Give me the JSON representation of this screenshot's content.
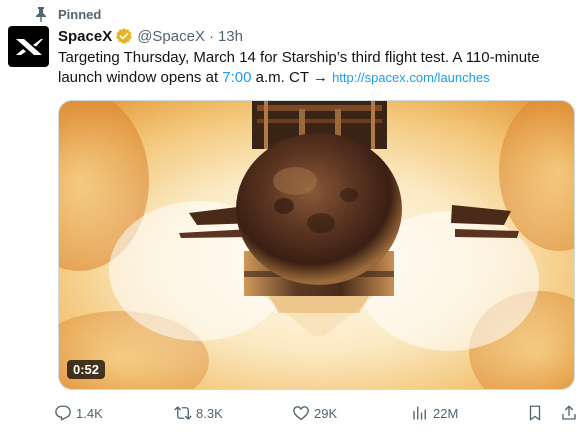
{
  "pinned": {
    "label": "Pinned",
    "icon": "pin-icon"
  },
  "author": {
    "name": "SpaceX",
    "handle": "@SpaceX",
    "separator": "·",
    "time": "13h",
    "verified_icon": "verified-badge-icon",
    "verified_color": "#e7b325",
    "avatar_icon": "spacex-logo-icon"
  },
  "tweet": {
    "text_part1": "Targeting Thursday, March 14 for Starship’s third flight test. A 110-minute launch window opens at ",
    "time_link": "7:00",
    "text_part2": " a.m. CT → ",
    "url": "http://spacex.com/launches"
  },
  "media": {
    "duration": "0:52"
  },
  "actions": {
    "replies": "1.4K",
    "reposts": "8.3K",
    "likes": "29K",
    "views": "22M"
  },
  "colors": {
    "link": "#1d9bf0",
    "muted": "#536471",
    "text": "#0f1419"
  }
}
